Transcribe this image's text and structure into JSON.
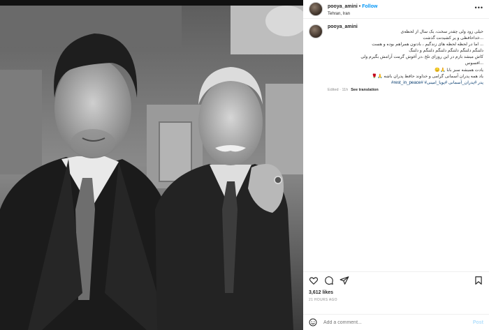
{
  "post": {
    "username": "pooya_amini",
    "follow_label": "Follow",
    "location": "Tehran, Iran",
    "more_icon": "more-horizontal-icon"
  },
  "photo": {
    "description_icon": "photo"
  },
  "caption": {
    "username": "pooya_amini",
    "lines": [
      "خیلی زود ولی چقدر سخت، یک سال از لحظه‌ی",
      "...خداحافظی و پر کشیدنت گذشت",
      "... اما در لحظه لحظه های زندگیم ، بادتون همراهم بوده و هست",
      "دلتنگم دلتنگم دلتنگم دلتنگم دلتنگم و دلتنگ",
      "کاش میشد بازم در این روزای تلخ ،در آغوش گرمت آرامش بگیرم ولی",
      "...افسوس",
      "یادت همیشه سبز بابا 🙏😔",
      "یاد همه پدران آسمانی گرامی و خداوند حافظ پدران باشه 🙏🌹"
    ],
    "hashtags": "پدر #پدران_آسمانی #پویا_امینی# #rest_in_peace#",
    "edited": "Edited · 11h",
    "see_translation": "See translation"
  },
  "stats": {
    "likes": "3,612 likes",
    "time_ago": "21 HOURS AGO"
  },
  "comment": {
    "placeholder": "Add a comment...",
    "post_label": "Post"
  },
  "colors": {
    "link_blue": "#0095f6",
    "hashtag_blue": "#00376b",
    "muted_gray": "#8e8e8e",
    "post_disabled": "#b2dffc"
  }
}
